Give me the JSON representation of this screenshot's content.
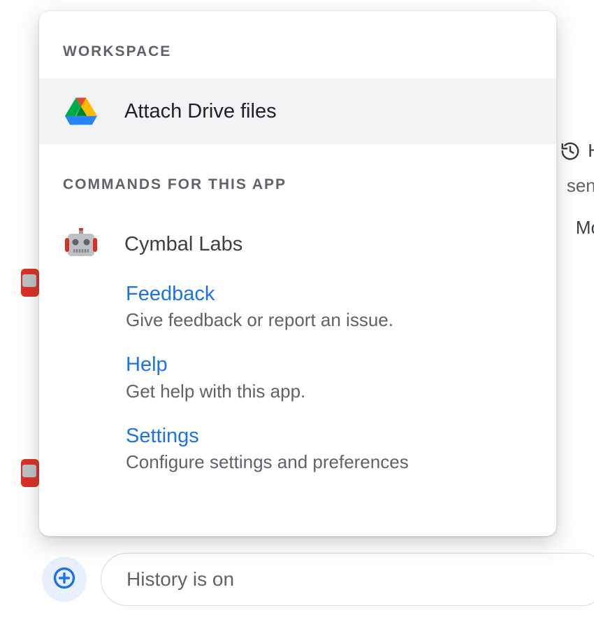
{
  "panel": {
    "workspace_label": "WORKSPACE",
    "attach_drive_label": "Attach Drive files",
    "commands_label": "COMMANDS FOR THIS APP",
    "app_name": "Cymbal Labs",
    "commands": [
      {
        "name": "Feedback",
        "desc": "Give feedback or report an issue."
      },
      {
        "name": "Help",
        "desc": "Get help with this app."
      },
      {
        "name": "Settings",
        "desc": "Configure settings and preferences"
      }
    ]
  },
  "compose": {
    "placeholder": "History is on"
  },
  "bg": {
    "hint_history_letter": "H",
    "hint_sent_fragment": "sent",
    "hint_more_fragment": "Mo"
  },
  "colors": {
    "link_blue": "#1a73e8",
    "muted": "#5f6368",
    "highlight_bg": "#f1f3f4",
    "plus_bg": "#e8f0fe"
  }
}
